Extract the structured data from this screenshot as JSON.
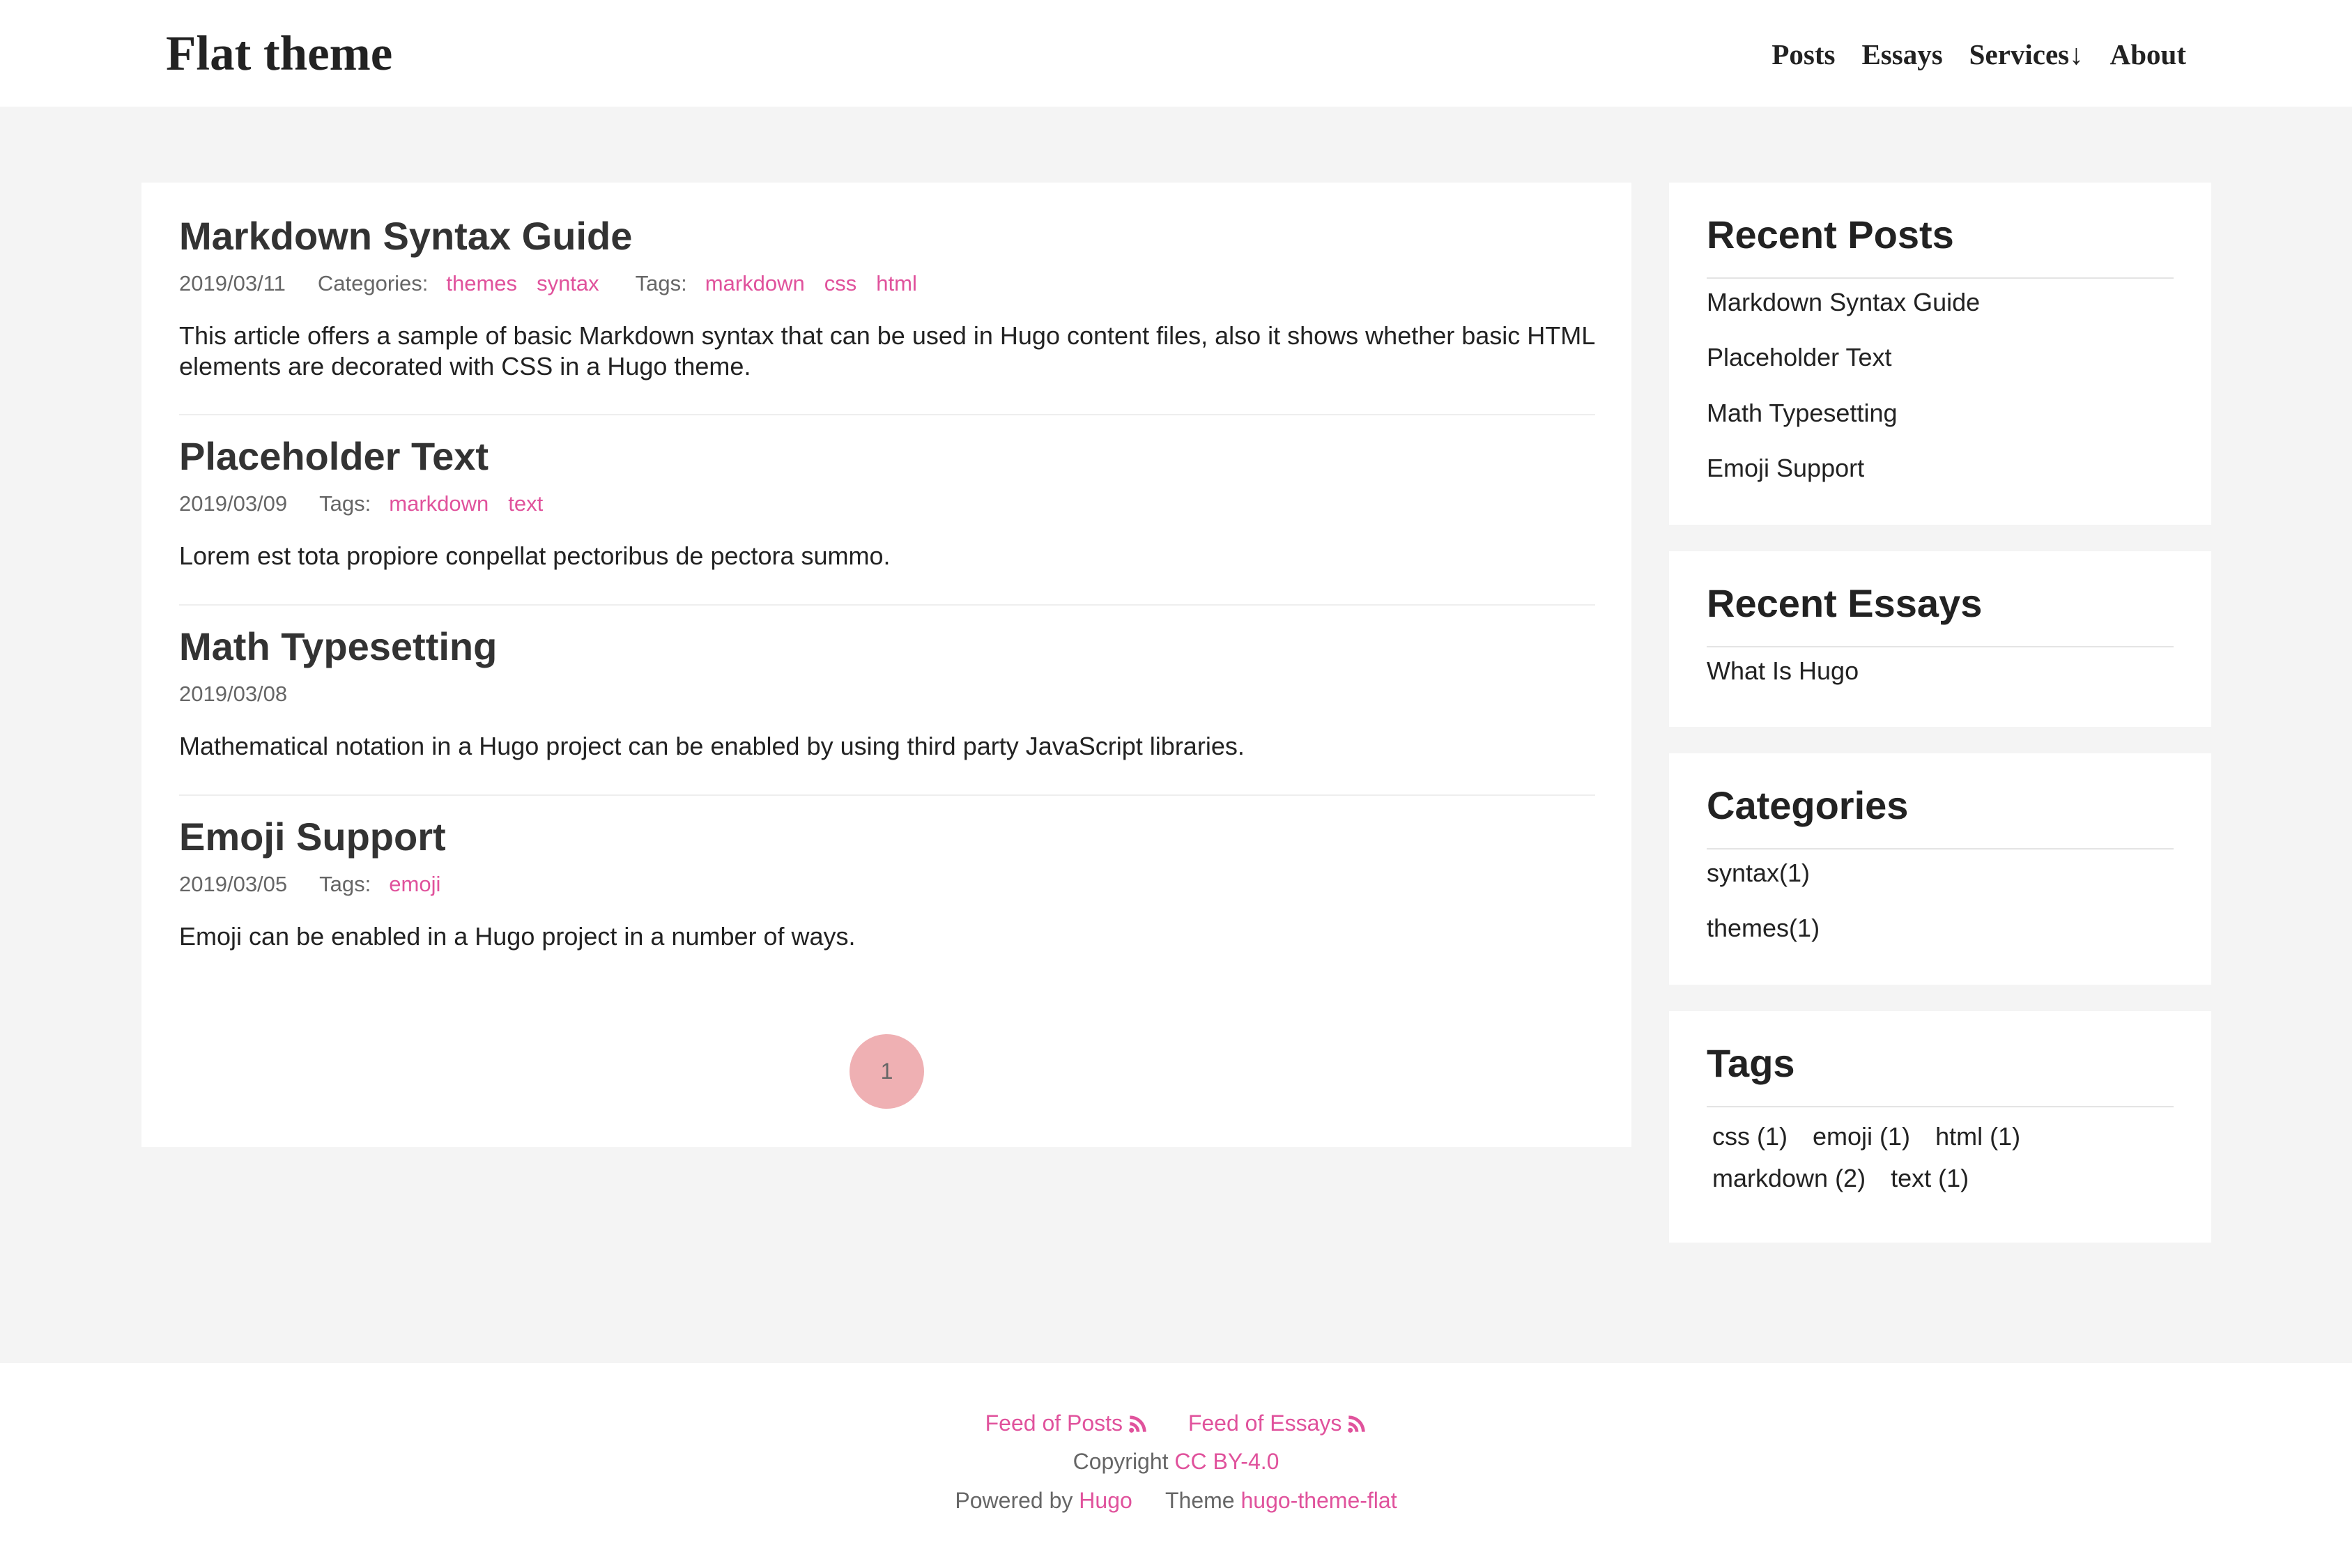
{
  "header": {
    "site_title": "Flat theme",
    "nav": [
      "Posts",
      "Essays",
      "Services↓",
      "About"
    ]
  },
  "posts": [
    {
      "title": "Markdown Syntax Guide",
      "date": "2019/03/11",
      "categories_label": "Categories:",
      "categories": [
        "themes",
        "syntax"
      ],
      "tags_label": "Tags:",
      "tags": [
        "markdown",
        "css",
        "html"
      ],
      "summary": "This article offers a sample of basic Markdown syntax that can be used in Hugo content files, also it shows whether basic HTML elements are decorated with CSS in a Hugo theme."
    },
    {
      "title": "Placeholder Text",
      "date": "2019/03/09",
      "tags_label": "Tags:",
      "tags": [
        "markdown",
        "text"
      ],
      "summary": "Lorem est tota propiore conpellat pectoribus de pectora summo."
    },
    {
      "title": "Math Typesetting",
      "date": "2019/03/08",
      "summary": "Mathematical notation in a Hugo project can be enabled by using third party JavaScript libraries."
    },
    {
      "title": "Emoji Support",
      "date": "2019/03/05",
      "tags_label": "Tags:",
      "tags": [
        "emoji"
      ],
      "summary": "Emoji can be enabled in a Hugo project in a number of ways."
    }
  ],
  "pagination": {
    "current": "1"
  },
  "sidebar": {
    "recent_posts": {
      "title": "Recent Posts",
      "items": [
        "Markdown Syntax Guide",
        "Placeholder Text",
        "Math Typesetting",
        "Emoji Support"
      ]
    },
    "recent_essays": {
      "title": "Recent Essays",
      "items": [
        "What Is Hugo"
      ]
    },
    "categories": {
      "title": "Categories",
      "items": [
        "syntax(1)",
        "themes(1)"
      ]
    },
    "tags": {
      "title": "Tags",
      "items": [
        "css (1)",
        "emoji (1)",
        "html (1)",
        "markdown (2)",
        "text (1)"
      ]
    }
  },
  "footer": {
    "feed_posts": "Feed of Posts",
    "feed_essays": "Feed of Essays",
    "copyright_label": "Copyright",
    "license": "CC BY-4.0",
    "powered_label": "Powered by",
    "hugo": "Hugo",
    "theme_label": "Theme",
    "theme_name": "hugo-theme-flat",
    "rss_icon": "rss-icon"
  },
  "colors": {
    "accent": "#e0529c",
    "pager_bg": "#efb0b3",
    "page_bg": "#f4f4f4"
  }
}
